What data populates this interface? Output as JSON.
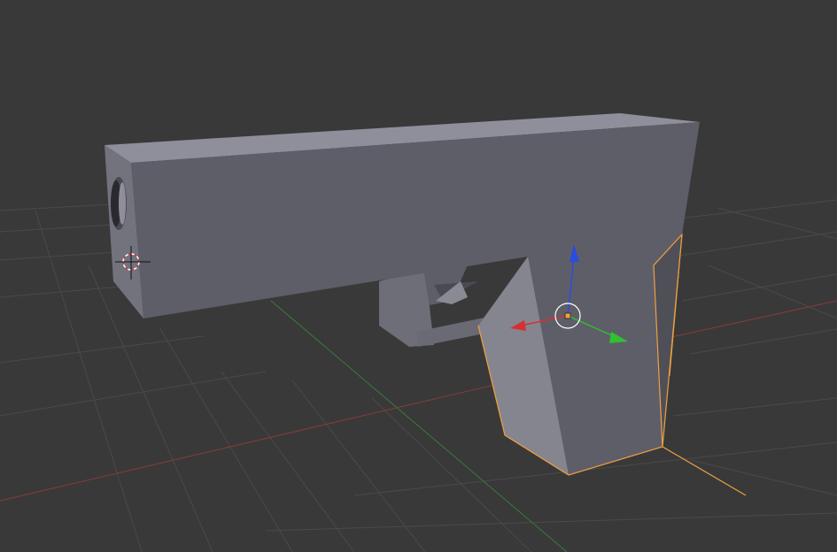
{
  "viewport": {
    "background": "#393939",
    "grid_color": "#4a4a4a",
    "x_axis_color": "#8a3a3a",
    "y_axis_color": "#3c7a3c"
  },
  "model": {
    "face_light": "#8f8f9c",
    "face_mid": "#5e5e69",
    "face_dark": "#4a4a53",
    "selection_outline": "#f0a040"
  },
  "cursor_3d": {
    "icon": "3d-cursor-icon"
  },
  "transform_gizmo": {
    "icon": "translate-manipulator-icon",
    "x_color": "#d83030",
    "y_color": "#30c030",
    "z_color": "#2a4ce0",
    "origin_color": "#f0a040"
  }
}
